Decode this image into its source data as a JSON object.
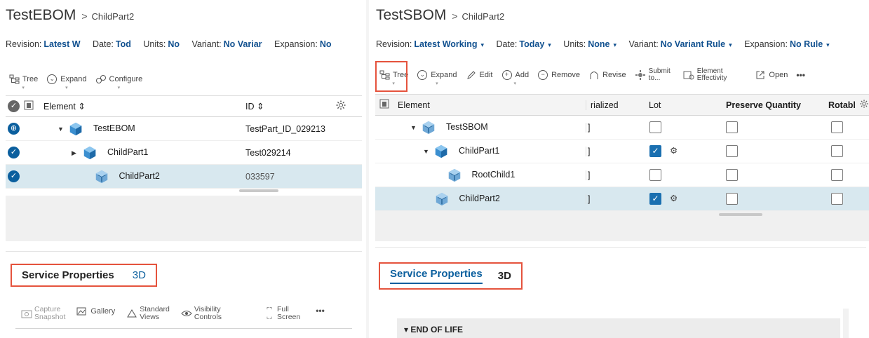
{
  "left": {
    "title": "TestEBOM",
    "breadcrumb_sep": ">",
    "breadcrumb_child": "ChildPart2",
    "context": {
      "revision_label": "Revision:",
      "revision_value": "Latest W",
      "date_label": "Date:",
      "date_value": "Tod",
      "units_label": "Units:",
      "units_value": "No",
      "variant_label": "Variant:",
      "variant_value": "No Variar",
      "expansion_label": "Expansion:",
      "expansion_value": "No"
    },
    "toolbar": {
      "tree": "Tree",
      "expand": "Expand",
      "configure": "Configure"
    },
    "columns": {
      "element": "Element",
      "id": "ID"
    },
    "rows": [
      {
        "name": "TestEBOM",
        "id": "TestPart_ID_029213"
      },
      {
        "name": "ChildPart1",
        "id": "Test029214"
      },
      {
        "name": "ChildPart2",
        "id": "033597"
      }
    ],
    "tabs": {
      "service": "Service Properties",
      "threed": "3D"
    },
    "viewer_toolbar": {
      "capture_1": "Capture",
      "capture_2": "Snapshot",
      "gallery": "Gallery",
      "standard_1": "Standard",
      "standard_2": "Views",
      "visibility_1": "Visibility",
      "visibility_2": "Controls",
      "full_1": "Full",
      "full_2": "Screen",
      "more": "•••"
    }
  },
  "right": {
    "title": "TestSBOM",
    "breadcrumb_sep": ">",
    "breadcrumb_child": "ChildPart2",
    "context": {
      "revision_label": "Revision:",
      "revision_value": "Latest Working",
      "date_label": "Date:",
      "date_value": "Today",
      "units_label": "Units:",
      "units_value": "None",
      "variant_label": "Variant:",
      "variant_value": "No Variant Rule",
      "expansion_label": "Expansion:",
      "expansion_value": "No Rule"
    },
    "toolbar": {
      "tree": "Tree",
      "expand": "Expand",
      "edit": "Edit",
      "add": "Add",
      "remove": "Remove",
      "revise": "Revise",
      "submit_1": "Submit",
      "submit_2": "to...",
      "effectivity_1": "Element",
      "effectivity_2": "Effectivity",
      "open": "Open",
      "more": "•••"
    },
    "columns": {
      "element": "Element",
      "serialized": "rialized",
      "lot": "Lot",
      "preserve": "Preserve Quantity",
      "rotable": "Rotabl"
    },
    "rows": [
      {
        "name": "TestSBOM",
        "lot": false
      },
      {
        "name": "ChildPart1",
        "lot": true
      },
      {
        "name": "RootChild1",
        "lot": false
      },
      {
        "name": "ChildPart2",
        "lot": true
      }
    ],
    "tabs": {
      "service": "Service Properties",
      "threed": "3D"
    },
    "section": "▾ END OF LIFE"
  }
}
